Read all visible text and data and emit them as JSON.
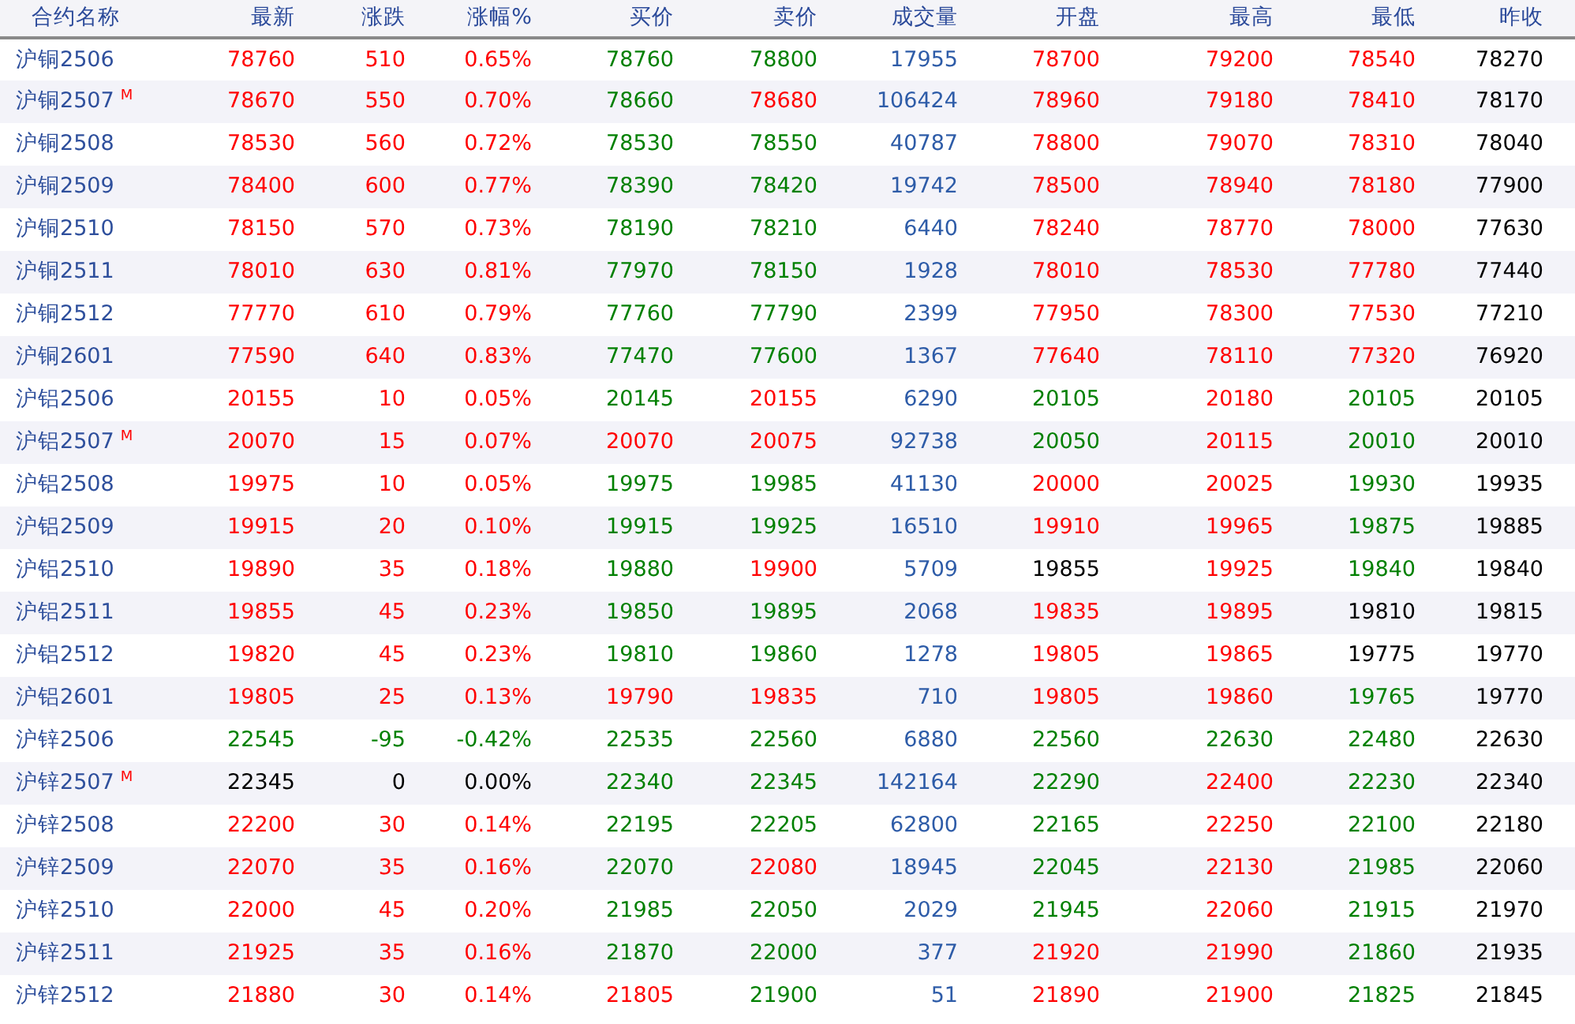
{
  "table": {
    "columns": [
      "合约名称",
      "最新",
      "涨跌",
      "涨幅%",
      "买价",
      "卖价",
      "成交量",
      "开盘",
      "最高",
      "最低",
      "昨收"
    ],
    "rows": [
      {
        "cells": [
          {
            "text": "沪铜2506",
            "color": "#2e4f9c"
          },
          {
            "text": "78760",
            "color": "#ff0000"
          },
          {
            "text": "510",
            "color": "#ff0000"
          },
          {
            "text": "0.65%",
            "color": "#ff0000"
          },
          {
            "text": "78760",
            "color": "#008000"
          },
          {
            "text": "78800",
            "color": "#008000"
          },
          {
            "text": "17955",
            "color": "#2e5ca8"
          },
          {
            "text": "78700",
            "color": "#ff0000"
          },
          {
            "text": "79200",
            "color": "#ff0000"
          },
          {
            "text": "78540",
            "color": "#ff0000"
          },
          {
            "text": "78270",
            "color": "#000000"
          }
        ]
      },
      {
        "cells": [
          {
            "text": "沪铜2507",
            "color": "#2e4f9c",
            "tag": "M"
          },
          {
            "text": "78670",
            "color": "#ff0000"
          },
          {
            "text": "550",
            "color": "#ff0000"
          },
          {
            "text": "0.70%",
            "color": "#ff0000"
          },
          {
            "text": "78660",
            "color": "#008000"
          },
          {
            "text": "78680",
            "color": "#ff0000"
          },
          {
            "text": "106424",
            "color": "#2e5ca8"
          },
          {
            "text": "78960",
            "color": "#ff0000"
          },
          {
            "text": "79180",
            "color": "#ff0000"
          },
          {
            "text": "78410",
            "color": "#ff0000"
          },
          {
            "text": "78170",
            "color": "#000000"
          }
        ]
      },
      {
        "cells": [
          {
            "text": "沪铜2508",
            "color": "#2e4f9c"
          },
          {
            "text": "78530",
            "color": "#ff0000"
          },
          {
            "text": "560",
            "color": "#ff0000"
          },
          {
            "text": "0.72%",
            "color": "#ff0000"
          },
          {
            "text": "78530",
            "color": "#008000"
          },
          {
            "text": "78550",
            "color": "#008000"
          },
          {
            "text": "40787",
            "color": "#2e5ca8"
          },
          {
            "text": "78800",
            "color": "#ff0000"
          },
          {
            "text": "79070",
            "color": "#ff0000"
          },
          {
            "text": "78310",
            "color": "#ff0000"
          },
          {
            "text": "78040",
            "color": "#000000"
          }
        ]
      },
      {
        "cells": [
          {
            "text": "沪铜2509",
            "color": "#2e4f9c"
          },
          {
            "text": "78400",
            "color": "#ff0000"
          },
          {
            "text": "600",
            "color": "#ff0000"
          },
          {
            "text": "0.77%",
            "color": "#ff0000"
          },
          {
            "text": "78390",
            "color": "#008000"
          },
          {
            "text": "78420",
            "color": "#008000"
          },
          {
            "text": "19742",
            "color": "#2e5ca8"
          },
          {
            "text": "78500",
            "color": "#ff0000"
          },
          {
            "text": "78940",
            "color": "#ff0000"
          },
          {
            "text": "78180",
            "color": "#ff0000"
          },
          {
            "text": "77900",
            "color": "#000000"
          }
        ]
      },
      {
        "cells": [
          {
            "text": "沪铜2510",
            "color": "#2e4f9c"
          },
          {
            "text": "78150",
            "color": "#ff0000"
          },
          {
            "text": "570",
            "color": "#ff0000"
          },
          {
            "text": "0.73%",
            "color": "#ff0000"
          },
          {
            "text": "78190",
            "color": "#008000"
          },
          {
            "text": "78210",
            "color": "#008000"
          },
          {
            "text": "6440",
            "color": "#2e5ca8"
          },
          {
            "text": "78240",
            "color": "#ff0000"
          },
          {
            "text": "78770",
            "color": "#ff0000"
          },
          {
            "text": "78000",
            "color": "#ff0000"
          },
          {
            "text": "77630",
            "color": "#000000"
          }
        ]
      },
      {
        "cells": [
          {
            "text": "沪铜2511",
            "color": "#2e4f9c"
          },
          {
            "text": "78010",
            "color": "#ff0000"
          },
          {
            "text": "630",
            "color": "#ff0000"
          },
          {
            "text": "0.81%",
            "color": "#ff0000"
          },
          {
            "text": "77970",
            "color": "#008000"
          },
          {
            "text": "78150",
            "color": "#008000"
          },
          {
            "text": "1928",
            "color": "#2e5ca8"
          },
          {
            "text": "78010",
            "color": "#ff0000"
          },
          {
            "text": "78530",
            "color": "#ff0000"
          },
          {
            "text": "77780",
            "color": "#ff0000"
          },
          {
            "text": "77440",
            "color": "#000000"
          }
        ]
      },
      {
        "cells": [
          {
            "text": "沪铜2512",
            "color": "#2e4f9c"
          },
          {
            "text": "77770",
            "color": "#ff0000"
          },
          {
            "text": "610",
            "color": "#ff0000"
          },
          {
            "text": "0.79%",
            "color": "#ff0000"
          },
          {
            "text": "77760",
            "color": "#008000"
          },
          {
            "text": "77790",
            "color": "#008000"
          },
          {
            "text": "2399",
            "color": "#2e5ca8"
          },
          {
            "text": "77950",
            "color": "#ff0000"
          },
          {
            "text": "78300",
            "color": "#ff0000"
          },
          {
            "text": "77530",
            "color": "#ff0000"
          },
          {
            "text": "77210",
            "color": "#000000"
          }
        ]
      },
      {
        "cells": [
          {
            "text": "沪铜2601",
            "color": "#2e4f9c"
          },
          {
            "text": "77590",
            "color": "#ff0000"
          },
          {
            "text": "640",
            "color": "#ff0000"
          },
          {
            "text": "0.83%",
            "color": "#ff0000"
          },
          {
            "text": "77470",
            "color": "#008000"
          },
          {
            "text": "77600",
            "color": "#008000"
          },
          {
            "text": "1367",
            "color": "#2e5ca8"
          },
          {
            "text": "77640",
            "color": "#ff0000"
          },
          {
            "text": "78110",
            "color": "#ff0000"
          },
          {
            "text": "77320",
            "color": "#ff0000"
          },
          {
            "text": "76920",
            "color": "#000000"
          }
        ]
      },
      {
        "cells": [
          {
            "text": "沪铝2506",
            "color": "#2e4f9c"
          },
          {
            "text": "20155",
            "color": "#ff0000"
          },
          {
            "text": "10",
            "color": "#ff0000"
          },
          {
            "text": "0.05%",
            "color": "#ff0000"
          },
          {
            "text": "20145",
            "color": "#008000"
          },
          {
            "text": "20155",
            "color": "#ff0000"
          },
          {
            "text": "6290",
            "color": "#2e5ca8"
          },
          {
            "text": "20105",
            "color": "#008000"
          },
          {
            "text": "20180",
            "color": "#ff0000"
          },
          {
            "text": "20105",
            "color": "#008000"
          },
          {
            "text": "20105",
            "color": "#000000"
          }
        ]
      },
      {
        "cells": [
          {
            "text": "沪铝2507",
            "color": "#2e4f9c",
            "tag": "M"
          },
          {
            "text": "20070",
            "color": "#ff0000"
          },
          {
            "text": "15",
            "color": "#ff0000"
          },
          {
            "text": "0.07%",
            "color": "#ff0000"
          },
          {
            "text": "20070",
            "color": "#ff0000"
          },
          {
            "text": "20075",
            "color": "#ff0000"
          },
          {
            "text": "92738",
            "color": "#2e5ca8"
          },
          {
            "text": "20050",
            "color": "#008000"
          },
          {
            "text": "20115",
            "color": "#ff0000"
          },
          {
            "text": "20010",
            "color": "#008000"
          },
          {
            "text": "20010",
            "color": "#000000"
          }
        ]
      },
      {
        "cells": [
          {
            "text": "沪铝2508",
            "color": "#2e4f9c"
          },
          {
            "text": "19975",
            "color": "#ff0000"
          },
          {
            "text": "10",
            "color": "#ff0000"
          },
          {
            "text": "0.05%",
            "color": "#ff0000"
          },
          {
            "text": "19975",
            "color": "#008000"
          },
          {
            "text": "19985",
            "color": "#008000"
          },
          {
            "text": "41130",
            "color": "#2e5ca8"
          },
          {
            "text": "20000",
            "color": "#ff0000"
          },
          {
            "text": "20025",
            "color": "#ff0000"
          },
          {
            "text": "19930",
            "color": "#008000"
          },
          {
            "text": "19935",
            "color": "#000000"
          }
        ]
      },
      {
        "cells": [
          {
            "text": "沪铝2509",
            "color": "#2e4f9c"
          },
          {
            "text": "19915",
            "color": "#ff0000"
          },
          {
            "text": "20",
            "color": "#ff0000"
          },
          {
            "text": "0.10%",
            "color": "#ff0000"
          },
          {
            "text": "19915",
            "color": "#008000"
          },
          {
            "text": "19925",
            "color": "#008000"
          },
          {
            "text": "16510",
            "color": "#2e5ca8"
          },
          {
            "text": "19910",
            "color": "#ff0000"
          },
          {
            "text": "19965",
            "color": "#ff0000"
          },
          {
            "text": "19875",
            "color": "#008000"
          },
          {
            "text": "19885",
            "color": "#000000"
          }
        ]
      },
      {
        "cells": [
          {
            "text": "沪铝2510",
            "color": "#2e4f9c"
          },
          {
            "text": "19890",
            "color": "#ff0000"
          },
          {
            "text": "35",
            "color": "#ff0000"
          },
          {
            "text": "0.18%",
            "color": "#ff0000"
          },
          {
            "text": "19880",
            "color": "#008000"
          },
          {
            "text": "19900",
            "color": "#ff0000"
          },
          {
            "text": "5709",
            "color": "#2e5ca8"
          },
          {
            "text": "19855",
            "color": "#000000"
          },
          {
            "text": "19925",
            "color": "#ff0000"
          },
          {
            "text": "19840",
            "color": "#008000"
          },
          {
            "text": "19840",
            "color": "#000000"
          }
        ]
      },
      {
        "cells": [
          {
            "text": "沪铝2511",
            "color": "#2e4f9c"
          },
          {
            "text": "19855",
            "color": "#ff0000"
          },
          {
            "text": "45",
            "color": "#ff0000"
          },
          {
            "text": "0.23%",
            "color": "#ff0000"
          },
          {
            "text": "19850",
            "color": "#008000"
          },
          {
            "text": "19895",
            "color": "#008000"
          },
          {
            "text": "2068",
            "color": "#2e5ca8"
          },
          {
            "text": "19835",
            "color": "#ff0000"
          },
          {
            "text": "19895",
            "color": "#ff0000"
          },
          {
            "text": "19810",
            "color": "#000000"
          },
          {
            "text": "19815",
            "color": "#000000"
          }
        ]
      },
      {
        "cells": [
          {
            "text": "沪铝2512",
            "color": "#2e4f9c"
          },
          {
            "text": "19820",
            "color": "#ff0000"
          },
          {
            "text": "45",
            "color": "#ff0000"
          },
          {
            "text": "0.23%",
            "color": "#ff0000"
          },
          {
            "text": "19810",
            "color": "#008000"
          },
          {
            "text": "19860",
            "color": "#008000"
          },
          {
            "text": "1278",
            "color": "#2e5ca8"
          },
          {
            "text": "19805",
            "color": "#ff0000"
          },
          {
            "text": "19865",
            "color": "#ff0000"
          },
          {
            "text": "19775",
            "color": "#000000"
          },
          {
            "text": "19770",
            "color": "#000000"
          }
        ]
      },
      {
        "cells": [
          {
            "text": "沪铝2601",
            "color": "#2e4f9c"
          },
          {
            "text": "19805",
            "color": "#ff0000"
          },
          {
            "text": "25",
            "color": "#ff0000"
          },
          {
            "text": "0.13%",
            "color": "#ff0000"
          },
          {
            "text": "19790",
            "color": "#ff0000"
          },
          {
            "text": "19835",
            "color": "#ff0000"
          },
          {
            "text": "710",
            "color": "#2e5ca8"
          },
          {
            "text": "19805",
            "color": "#ff0000"
          },
          {
            "text": "19860",
            "color": "#ff0000"
          },
          {
            "text": "19765",
            "color": "#008000"
          },
          {
            "text": "19770",
            "color": "#000000"
          }
        ]
      },
      {
        "cells": [
          {
            "text": "沪锌2506",
            "color": "#2e4f9c"
          },
          {
            "text": "22545",
            "color": "#008000"
          },
          {
            "text": "-95",
            "color": "#008000"
          },
          {
            "text": "-0.42%",
            "color": "#008000"
          },
          {
            "text": "22535",
            "color": "#008000"
          },
          {
            "text": "22560",
            "color": "#008000"
          },
          {
            "text": "6880",
            "color": "#2e5ca8"
          },
          {
            "text": "22560",
            "color": "#008000"
          },
          {
            "text": "22630",
            "color": "#008000"
          },
          {
            "text": "22480",
            "color": "#008000"
          },
          {
            "text": "22630",
            "color": "#000000"
          }
        ]
      },
      {
        "cells": [
          {
            "text": "沪锌2507",
            "color": "#2e4f9c",
            "tag": "M"
          },
          {
            "text": "22345",
            "color": "#000000"
          },
          {
            "text": "0",
            "color": "#000000"
          },
          {
            "text": "0.00%",
            "color": "#000000"
          },
          {
            "text": "22340",
            "color": "#008000"
          },
          {
            "text": "22345",
            "color": "#008000"
          },
          {
            "text": "142164",
            "color": "#2e5ca8"
          },
          {
            "text": "22290",
            "color": "#008000"
          },
          {
            "text": "22400",
            "color": "#ff0000"
          },
          {
            "text": "22230",
            "color": "#008000"
          },
          {
            "text": "22340",
            "color": "#000000"
          }
        ]
      },
      {
        "cells": [
          {
            "text": "沪锌2508",
            "color": "#2e4f9c"
          },
          {
            "text": "22200",
            "color": "#ff0000"
          },
          {
            "text": "30",
            "color": "#ff0000"
          },
          {
            "text": "0.14%",
            "color": "#ff0000"
          },
          {
            "text": "22195",
            "color": "#008000"
          },
          {
            "text": "22205",
            "color": "#008000"
          },
          {
            "text": "62800",
            "color": "#2e5ca8"
          },
          {
            "text": "22165",
            "color": "#008000"
          },
          {
            "text": "22250",
            "color": "#ff0000"
          },
          {
            "text": "22100",
            "color": "#008000"
          },
          {
            "text": "22180",
            "color": "#000000"
          }
        ]
      },
      {
        "cells": [
          {
            "text": "沪锌2509",
            "color": "#2e4f9c"
          },
          {
            "text": "22070",
            "color": "#ff0000"
          },
          {
            "text": "35",
            "color": "#ff0000"
          },
          {
            "text": "0.16%",
            "color": "#ff0000"
          },
          {
            "text": "22070",
            "color": "#008000"
          },
          {
            "text": "22080",
            "color": "#ff0000"
          },
          {
            "text": "18945",
            "color": "#2e5ca8"
          },
          {
            "text": "22045",
            "color": "#008000"
          },
          {
            "text": "22130",
            "color": "#ff0000"
          },
          {
            "text": "21985",
            "color": "#008000"
          },
          {
            "text": "22060",
            "color": "#000000"
          }
        ]
      },
      {
        "cells": [
          {
            "text": "沪锌2510",
            "color": "#2e4f9c"
          },
          {
            "text": "22000",
            "color": "#ff0000"
          },
          {
            "text": "45",
            "color": "#ff0000"
          },
          {
            "text": "0.20%",
            "color": "#ff0000"
          },
          {
            "text": "21985",
            "color": "#008000"
          },
          {
            "text": "22050",
            "color": "#008000"
          },
          {
            "text": "2029",
            "color": "#2e5ca8"
          },
          {
            "text": "21945",
            "color": "#008000"
          },
          {
            "text": "22060",
            "color": "#ff0000"
          },
          {
            "text": "21915",
            "color": "#008000"
          },
          {
            "text": "21970",
            "color": "#000000"
          }
        ]
      },
      {
        "cells": [
          {
            "text": "沪锌2511",
            "color": "#2e4f9c"
          },
          {
            "text": "21925",
            "color": "#ff0000"
          },
          {
            "text": "35",
            "color": "#ff0000"
          },
          {
            "text": "0.16%",
            "color": "#ff0000"
          },
          {
            "text": "21870",
            "color": "#008000"
          },
          {
            "text": "22000",
            "color": "#008000"
          },
          {
            "text": "377",
            "color": "#2e5ca8"
          },
          {
            "text": "21920",
            "color": "#ff0000"
          },
          {
            "text": "21990",
            "color": "#ff0000"
          },
          {
            "text": "21860",
            "color": "#008000"
          },
          {
            "text": "21935",
            "color": "#000000"
          }
        ]
      },
      {
        "cells": [
          {
            "text": "沪锌2512",
            "color": "#2e4f9c"
          },
          {
            "text": "21880",
            "color": "#ff0000"
          },
          {
            "text": "30",
            "color": "#ff0000"
          },
          {
            "text": "0.14%",
            "color": "#ff0000"
          },
          {
            "text": "21805",
            "color": "#ff0000"
          },
          {
            "text": "21900",
            "color": "#008000"
          },
          {
            "text": "51",
            "color": "#2e5ca8"
          },
          {
            "text": "21890",
            "color": "#ff0000"
          },
          {
            "text": "21900",
            "color": "#ff0000"
          },
          {
            "text": "21825",
            "color": "#008000"
          },
          {
            "text": "21845",
            "color": "#000000"
          }
        ]
      }
    ]
  }
}
